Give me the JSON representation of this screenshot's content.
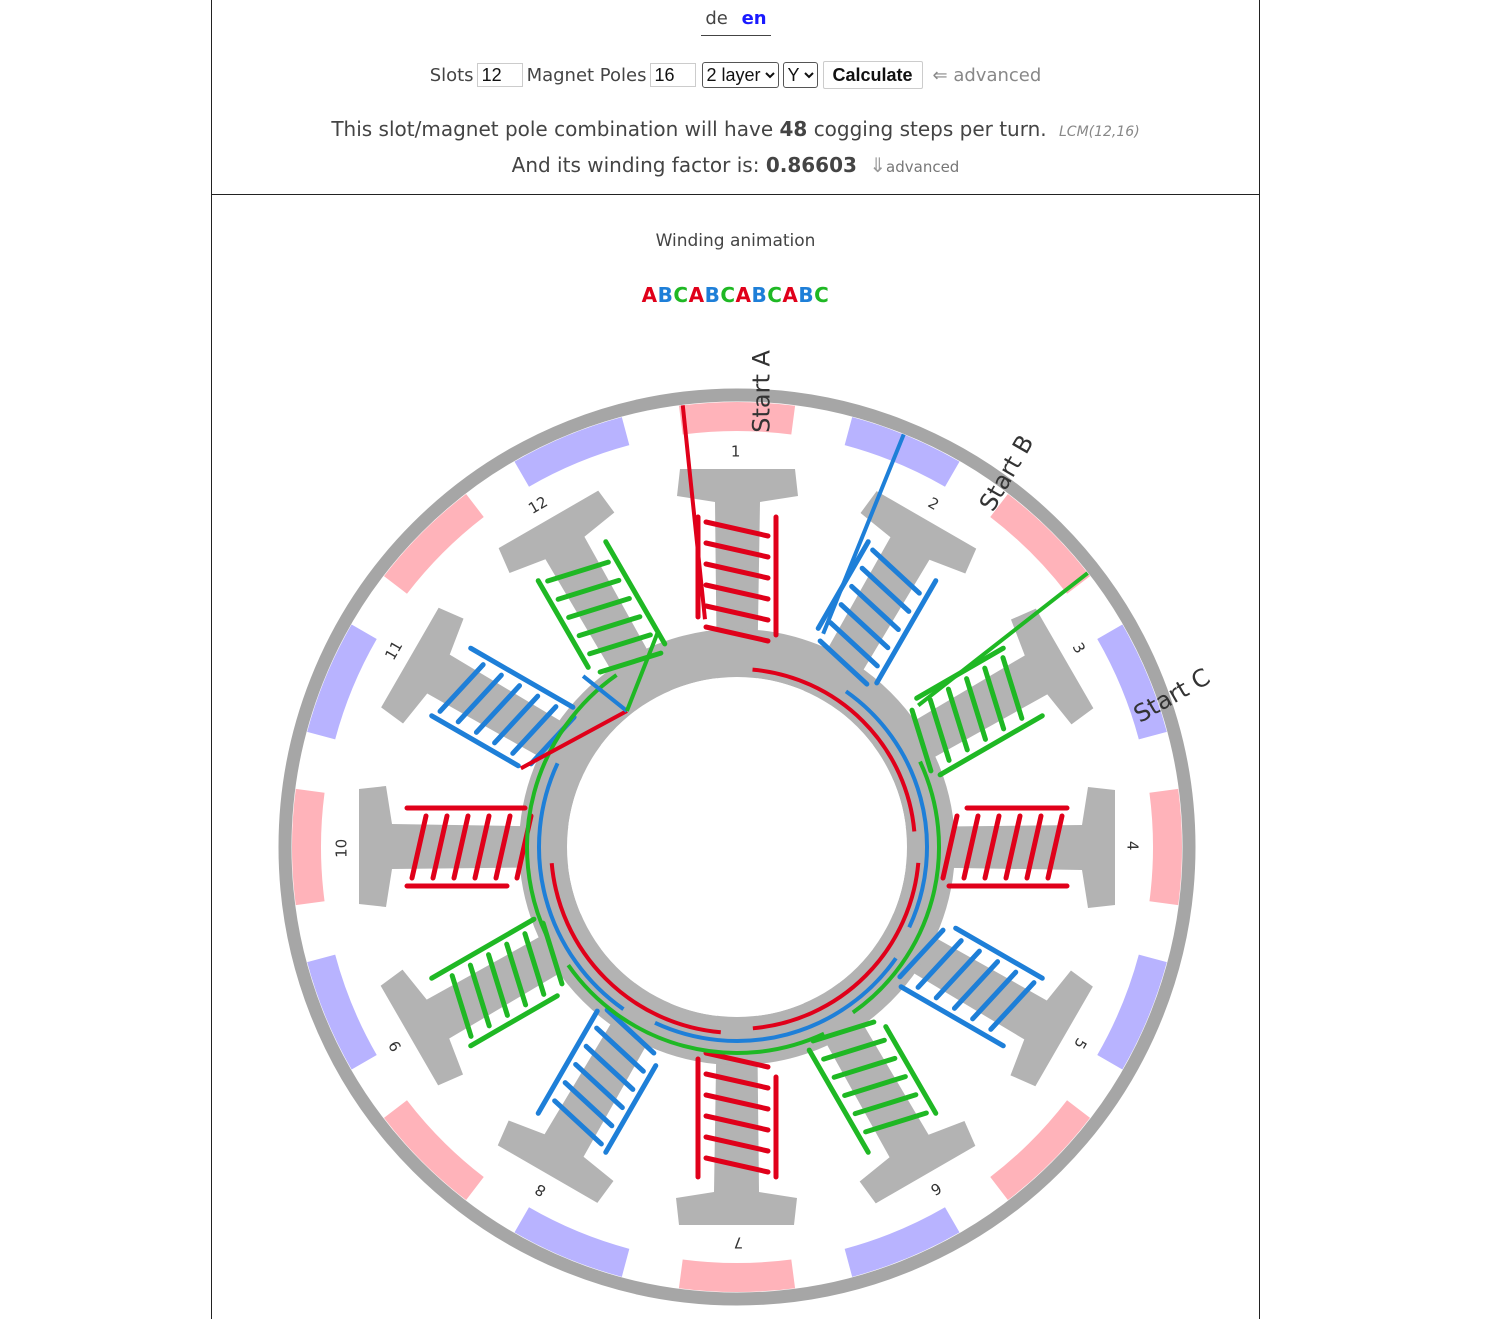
{
  "language": {
    "options": [
      "de",
      "en"
    ],
    "active": "en"
  },
  "form": {
    "slots_label": "Slots",
    "slots_value": "12",
    "poles_label": "Magnet Poles",
    "poles_value": "16",
    "layer_value": "2 layer",
    "connection_value": "Y",
    "calculate_label": "Calculate",
    "advanced_link": "⇐ advanced"
  },
  "result": {
    "cogging_prefix": "This slot/magnet pole combination will have",
    "cogging_steps": "48",
    "cogging_suffix": "cogging steps per turn.",
    "lcm": "LCM(12,16)",
    "winding_prefix": "And its winding factor is:",
    "winding_factor": "0.86603",
    "winding_arrow": "⇓",
    "winding_advanced": "advanced"
  },
  "animation": {
    "title": "Winding animation",
    "sequence": [
      "A",
      "B",
      "C",
      "A",
      "B",
      "C",
      "A",
      "B",
      "C",
      "A",
      "B",
      "C"
    ],
    "start_labels": [
      "Start A",
      "Start B",
      "Start C"
    ],
    "slot_numbers": [
      "1",
      "2",
      "3",
      "4",
      "5",
      "6",
      "7",
      "8",
      "9",
      "10",
      "11",
      "12"
    ],
    "phase_colors": {
      "A": "#e0001a",
      "B": "#1e7fd8",
      "C": "#1fb824"
    },
    "magnet_colors": {
      "north": "#ffb3ba",
      "south": "#b8b3ff"
    }
  }
}
